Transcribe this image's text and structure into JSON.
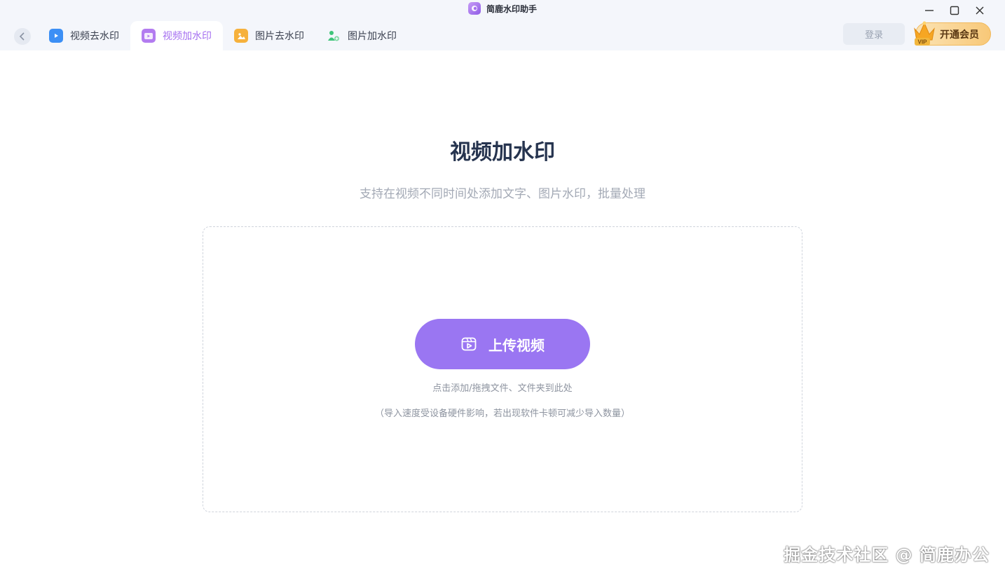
{
  "app": {
    "title": "简鹿水印助手"
  },
  "tabs": [
    {
      "label": "视频去水印",
      "icon": "video-remove-watermark-icon",
      "color": "#3c8ff5",
      "active": false
    },
    {
      "label": "视频加水印",
      "icon": "video-add-watermark-icon",
      "color": "#b37cf0",
      "active": true
    },
    {
      "label": "图片去水印",
      "icon": "image-remove-watermark-icon",
      "color": "#f6b13c",
      "active": false
    },
    {
      "label": "图片加水印",
      "icon": "image-add-watermark-icon",
      "color": "#3fc47a",
      "active": false
    }
  ],
  "header": {
    "login_label": "登录",
    "vip_label": "开通会员",
    "vip_badge": "VIP"
  },
  "main": {
    "title": "视频加水印",
    "subtitle": "支持在视频不同时间处添加文字、图片水印，批量处理",
    "upload_label": "上传视频",
    "hint_primary": "点击添加/拖拽文件、文件夹到此处",
    "hint_secondary": "（导入速度受设备硬件影响，若出现软件卡顿可减少导入数量）"
  },
  "overlay": {
    "watermark_text": "掘金技术社区 @ 简鹿办公"
  },
  "colors": {
    "accent": "#9a76f2",
    "active_tab_text": "#a46ef0",
    "title_text": "#26344f"
  }
}
